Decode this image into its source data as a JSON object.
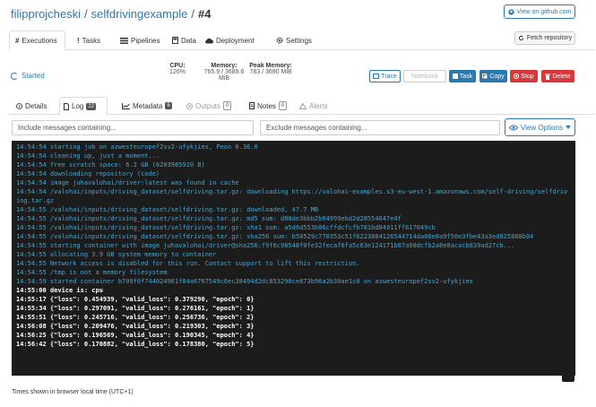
{
  "header": {
    "owner": "filipprojcheski",
    "separator": "/",
    "project": "selfdrivingexample",
    "execution": "#4",
    "github_label": "View on github.com"
  },
  "tabs": [
    {
      "label": "Executions",
      "icon": "hash-icon"
    },
    {
      "label": "Tasks",
      "icon": "exclamation-icon"
    },
    {
      "label": "Pipelines",
      "icon": "pipelines-icon"
    },
    {
      "label": "Data",
      "icon": "data-icon"
    },
    {
      "label": "Deployment",
      "icon": "cloud-icon"
    },
    {
      "label": "Settings",
      "icon": "gear-icon"
    }
  ],
  "fetch_label": "Fetch repository",
  "status": {
    "label": "Started",
    "cpu_label": "CPU:",
    "cpu_value": "126%",
    "memory_label": "Memory:",
    "memory_value": "765.9 / 3689.6",
    "memory_unit": "MiB",
    "peak_label": "Peak Memory:",
    "peak_value": "783 / 3690 MiB"
  },
  "actions": {
    "trace": "Trace",
    "notebook": "Notebook",
    "task": "Task",
    "copy": "Copy",
    "stop": "Stop",
    "delete": "Delete"
  },
  "subtabs": [
    {
      "label": "Details",
      "badge": ""
    },
    {
      "label": "Log",
      "badge": "22"
    },
    {
      "label": "Metadata",
      "badge": "6"
    },
    {
      "label": "Outputs",
      "badge": "0"
    },
    {
      "label": "Notes",
      "badge": "0"
    },
    {
      "label": "Alerts",
      "badge": ""
    }
  ],
  "filters": {
    "include_placeholder": "Include messages containing...",
    "exclude_placeholder": "Exclude messages containing...",
    "view_options": "View Options"
  },
  "log_lines": [
    {
      "kind": "info",
      "text": "14:54:54 starting job on azwesteuropef2sv2-ufykjies, Peon 0.36.0"
    },
    {
      "kind": "info",
      "text": "14:54:54 cleaning up, just a moment..."
    },
    {
      "kind": "info",
      "text": "14:54:54 free scratch space: 6.2 GB (6203985920 B)"
    },
    {
      "kind": "info",
      "text": "14:54:54 downloading repository (code)"
    },
    {
      "kind": "info",
      "text": "14:54:54 image juhavalohai/driver:latest was found in cache"
    },
    {
      "kind": "info",
      "text": "14:54:54 /valohai/inputs/driving_dataset/selfdriving.tar.gz: downloading https://valohai-examples.s3-eu-west-1.amazonaws.com/self-driving/selfdriving.tar.gz"
    },
    {
      "kind": "info",
      "text": "14:54:55 /valohai/inputs/driving_dataset/selfdriving.tar.gz: downloaded, 47.7 MB"
    },
    {
      "kind": "info",
      "text": "14:54:55 /valohai/inputs/driving_dataset/selfdriving.tar.gz: md5 sum: d08de3bbb2b04999ebd2d28554647e4f"
    },
    {
      "kind": "info",
      "text": "14:54:55 /valohai/inputs/driving_dataset/selfdriving.tar.gz: sha1 sum: a5d6d553b06cffdcfcfb781bd84911ff617049cb"
    },
    {
      "kind": "info",
      "text": "14:54:55 /valohai/inputs/driving_dataset/selfdriving.tar.gz: sha256 sum: b50529c770353c51f6223884126544714da00e8a9f50e3fbe43a3ed825888b04"
    },
    {
      "kind": "info",
      "text": "14:54:55 starting container with image juhavalohai/driver@sha256:f9f6c98548f0fe32fecaf6fa5c63e124171b87a98dcfb2a8e8acacb839ad27cb..."
    },
    {
      "kind": "info",
      "text": "14:54:55 allocating 3.9 GB system memory to container"
    },
    {
      "kind": "info",
      "text": "14:54:55 Network access is disabled for this run. Contact support to lift this restriction."
    },
    {
      "kind": "info",
      "text": "14:54:55 /tmp is not a memory filesystem"
    },
    {
      "kind": "info",
      "text": "14:54:59 started container b709f0f744024961f84a6767549c6ec38494d2dc853290ce873b96a2b30ae1c0 on azwesteuropef2sv2-ufykjies"
    },
    {
      "kind": "out",
      "text": "14:55:00 device is: cpu"
    },
    {
      "kind": "out",
      "text": "14:55:17 {\"loss\": 0.454939, \"valid_loss\": 0.379290, \"epoch\": 0}"
    },
    {
      "kind": "out",
      "text": "14:55:34 {\"loss\": 0.297091, \"valid_loss\": 0.276161, \"epoch\": 1}"
    },
    {
      "kind": "out",
      "text": "14:55:51 {\"loss\": 0.245716, \"valid_loss\": 0.256736, \"epoch\": 2}"
    },
    {
      "kind": "out",
      "text": "14:56:08 {\"loss\": 0.209476, \"valid_loss\": 0.219303, \"epoch\": 3}"
    },
    {
      "kind": "out",
      "text": "14:56:25 {\"loss\": 0.196569, \"valid_loss\": 0.190345, \"epoch\": 4}"
    },
    {
      "kind": "out",
      "text": "14:56:42 {\"loss\": 0.170882, \"valid_loss\": 0.178380, \"epoch\": 5}"
    }
  ],
  "footer_note": "Times shown in browser local time (UTC+1)",
  "colors": {
    "accent": "#2a7ab0",
    "danger": "#d9383a",
    "log_bg": "#1c1c1c",
    "log_info": "#3fa7d6",
    "log_out": "#ffffff"
  }
}
